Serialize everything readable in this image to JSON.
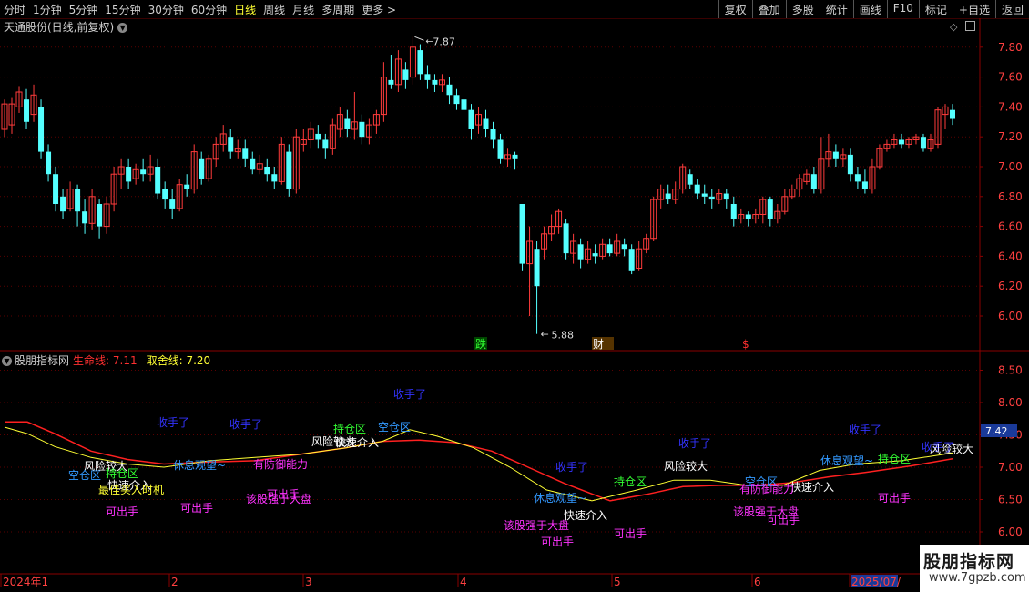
{
  "toolbar": {
    "periods": [
      "分时",
      "1分钟",
      "5分钟",
      "15分钟",
      "30分钟",
      "60分钟",
      "日线",
      "周线",
      "月线",
      "多周期",
      "更多 >"
    ],
    "active_period": "日线",
    "actions": [
      "复权",
      "叠加",
      "多股",
      "统计",
      "画线",
      "F10",
      "标记",
      "+自选",
      "返回"
    ]
  },
  "main_chart": {
    "title": "天通股份(日线,前复权)",
    "high_label": "7.87",
    "low_label": "5.88",
    "y_ticks": [
      "7.80",
      "7.60",
      "7.40",
      "7.20",
      "7.00",
      "6.80",
      "6.60",
      "6.40",
      "6.20",
      "6.00"
    ],
    "markers": [
      {
        "text": "跌",
        "color": "#33ff33",
        "bg": "#004400"
      },
      {
        "text": "财",
        "color": "#ffffff",
        "bg": "#553300"
      },
      {
        "text": "$",
        "color": "#ff3030",
        "bg": ""
      }
    ]
  },
  "indicator": {
    "name": "股朋指标网",
    "life_line_label": "生命线: 7.11",
    "take_line_label": "取舍线: 7.20",
    "y_ticks": [
      "8.50",
      "8.00",
      "7.50",
      "7.00",
      "6.50",
      "6.00"
    ],
    "current_value": "7.42",
    "annotations": [
      {
        "text": "收手了",
        "color": "#3333ff"
      },
      {
        "text": "收手了",
        "color": "#3333ff"
      },
      {
        "text": "收手了",
        "color": "#3333ff"
      },
      {
        "text": "收手了",
        "color": "#3333ff"
      },
      {
        "text": "收手了",
        "color": "#3333ff"
      },
      {
        "text": "收手了",
        "color": "#3333ff"
      },
      {
        "text": "收手了",
        "color": "#3333ff"
      },
      {
        "text": "风险较大",
        "color": "#ffffff"
      },
      {
        "text": "风险较大",
        "color": "#ffffff"
      },
      {
        "text": "风险较大",
        "color": "#ffffff"
      },
      {
        "text": "风险较大",
        "color": "#ffffff"
      },
      {
        "text": "空仓区",
        "color": "#3399ff"
      },
      {
        "text": "空仓区",
        "color": "#3399ff"
      },
      {
        "text": "空仓区",
        "color": "#3399ff"
      },
      {
        "text": "持仓区",
        "color": "#33ff33"
      },
      {
        "text": "持仓区",
        "color": "#33ff33"
      },
      {
        "text": "持仓区",
        "color": "#33ff33"
      },
      {
        "text": "持仓区",
        "color": "#33ff33"
      },
      {
        "text": "快速介入",
        "color": "#ffffff"
      },
      {
        "text": "快速介入",
        "color": "#ffffff"
      },
      {
        "text": "快速介入",
        "color": "#ffffff"
      },
      {
        "text": "快速介入",
        "color": "#ffffff"
      },
      {
        "text": "最佳买入时机",
        "color": "#ffff33"
      },
      {
        "text": "休息观望~",
        "color": "#3399ff"
      },
      {
        "text": "休息观望~",
        "color": "#3399ff"
      },
      {
        "text": "休息观望~",
        "color": "#3399ff"
      },
      {
        "text": "有防御能力",
        "color": "#ff33ff"
      },
      {
        "text": "有防御能力",
        "color": "#ff33ff"
      },
      {
        "text": "该股强于大盘",
        "color": "#ff33ff"
      },
      {
        "text": "该股强于大盘",
        "color": "#ff33ff"
      },
      {
        "text": "该股强于大盘",
        "color": "#ff33ff"
      },
      {
        "text": "可出手",
        "color": "#ff33ff"
      },
      {
        "text": "可出手",
        "color": "#ff33ff"
      },
      {
        "text": "可出手",
        "color": "#ff33ff"
      },
      {
        "text": "可出手",
        "color": "#ff33ff"
      },
      {
        "text": "可出手",
        "color": "#ff33ff"
      },
      {
        "text": "可出手",
        "color": "#ff33ff"
      },
      {
        "text": "可出手",
        "color": "#ff33ff"
      }
    ]
  },
  "time_axis": {
    "labels": [
      "2024年1",
      "2",
      "3",
      "4",
      "5",
      "6",
      "2025/07/"
    ]
  },
  "watermark": {
    "title": "股朋指标网",
    "url": "www.7gpzb.com"
  },
  "colors": {
    "up": "#ff3b3b",
    "down": "#54ffff",
    "life_line": "#ff2020",
    "take_line": "#ffff33",
    "grid": "#5a0000"
  }
}
